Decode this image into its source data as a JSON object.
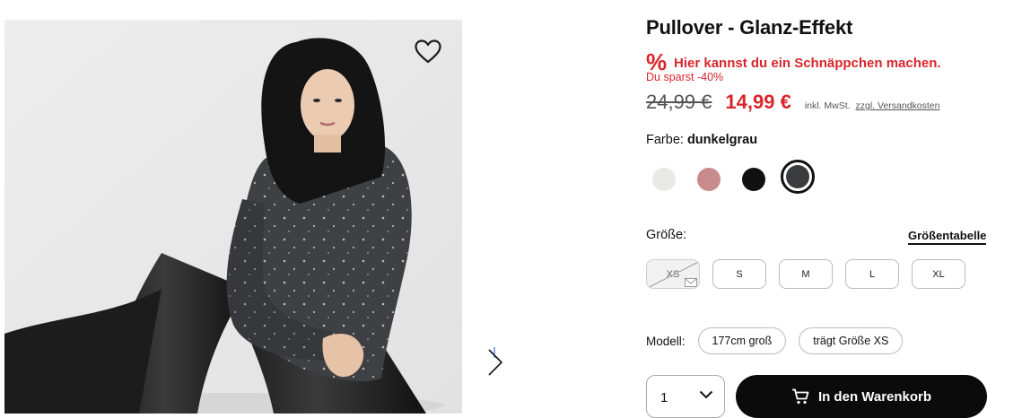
{
  "product": {
    "title": "Pullover - Glanz-Effekt",
    "image_alt": "Model im dunkelgrauen Pullover mit Glanz-Effekt"
  },
  "promo": {
    "icon": "percent-icon",
    "icon_glyph": "%",
    "text": "Hier kannst du ein Schnäppchen machen.",
    "savings": "Du sparst -40%"
  },
  "price": {
    "old": "24,99 €",
    "new": "14,99 €",
    "tax_prefix": "inkl. MwSt.",
    "shipping_link": "zzgl. Versandkosten"
  },
  "color": {
    "label": "Farbe:",
    "selected_name": "dunkelgrau",
    "swatches": [
      {
        "name": "hellgrau",
        "hex": "#e9e9e7"
      },
      {
        "name": "rosa",
        "hex": "#c98a8c"
      },
      {
        "name": "schwarz",
        "hex": "#111111"
      },
      {
        "name": "dunkelgrau",
        "hex": "#3a3b3d",
        "selected": true
      }
    ]
  },
  "size": {
    "label": "Größe:",
    "chart_link": "Größentabelle",
    "options": [
      {
        "label": "XS",
        "available": false
      },
      {
        "label": "S",
        "available": true
      },
      {
        "label": "M",
        "available": true
      },
      {
        "label": "L",
        "available": true
      },
      {
        "label": "XL",
        "available": true
      }
    ]
  },
  "model": {
    "label": "Modell:",
    "height": "177cm groß",
    "size_worn": "trägt Größe XS"
  },
  "quantity": {
    "value": "1"
  },
  "cart": {
    "label": "In den Warenkorb"
  },
  "colors": {
    "sale_red": "#d8262c",
    "button_black": "#0b0b0b"
  }
}
